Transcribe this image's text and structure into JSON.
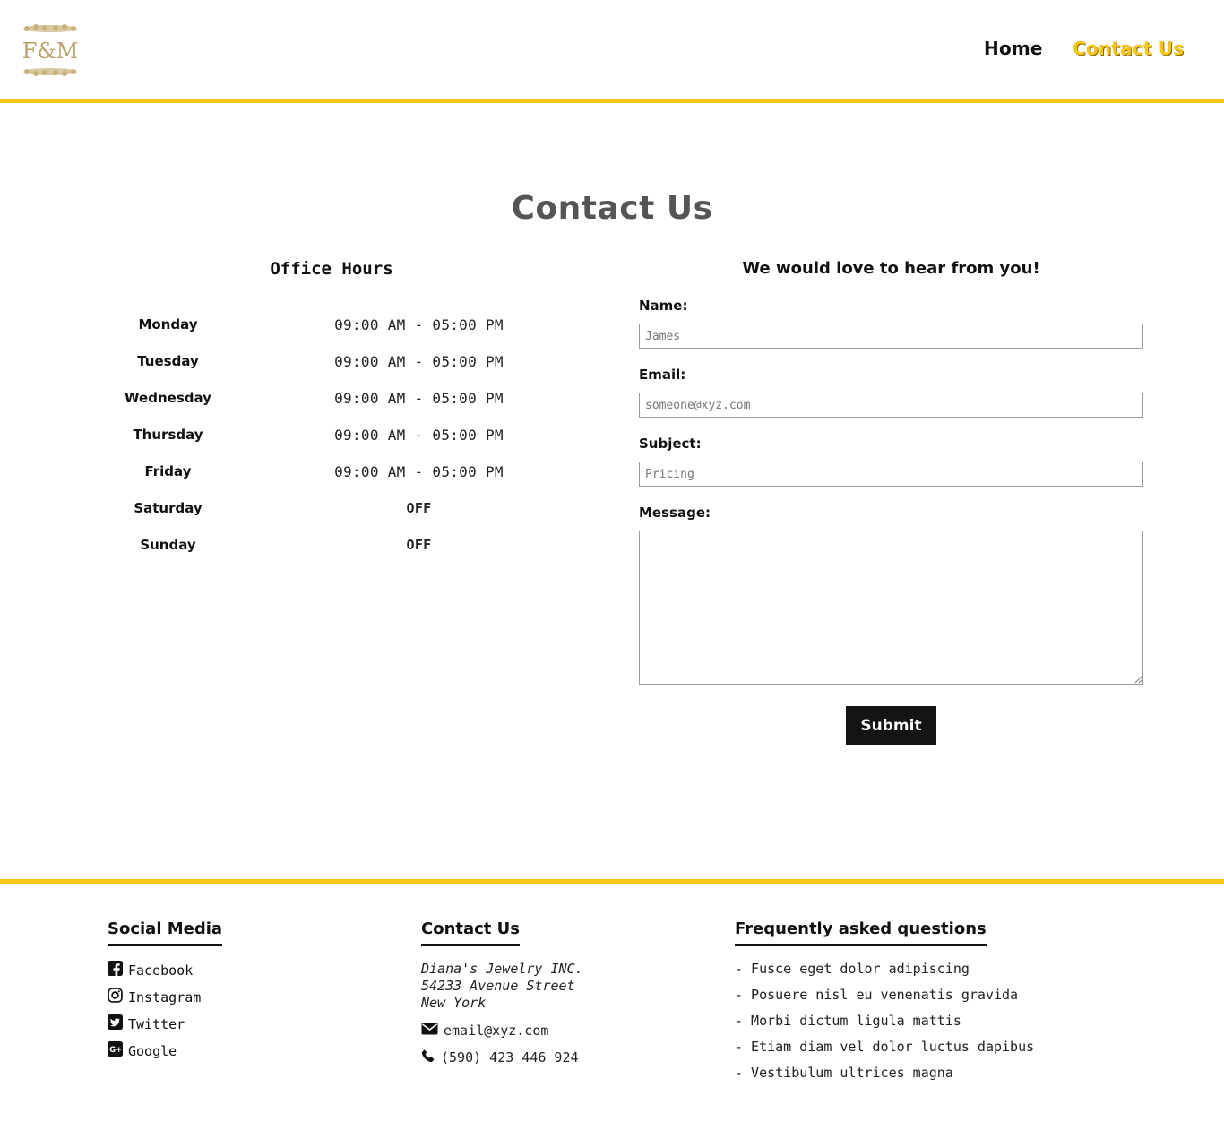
{
  "header": {
    "logo_text": "F&M",
    "nav": [
      {
        "label": "Home"
      },
      {
        "label": "Contact Us"
      }
    ],
    "accent_color": "#f5c518"
  },
  "main": {
    "title": "Contact Us",
    "office_hours": {
      "title": "Office Hours",
      "rows": [
        {
          "day": "Monday",
          "hours": "09:00 AM - 05:00 PM"
        },
        {
          "day": "Tuesday",
          "hours": "09:00 AM - 05:00 PM"
        },
        {
          "day": "Wednesday",
          "hours": "09:00 AM - 05:00 PM"
        },
        {
          "day": "Thursday",
          "hours": "09:00 AM - 05:00 PM"
        },
        {
          "day": "Friday",
          "hours": "09:00 AM - 05:00 PM"
        },
        {
          "day": "Saturday",
          "hours": "OFF"
        },
        {
          "day": "Sunday",
          "hours": "OFF"
        }
      ]
    },
    "form": {
      "title": "We would love to hear from you!",
      "name_label": "Name:",
      "name_placeholder": "James",
      "email_label": "Email:",
      "email_placeholder": "someone@xyz.com",
      "subject_label": "Subject:",
      "subject_placeholder": "Pricing",
      "message_label": "Message:",
      "message_value": "",
      "submit_label": "Submit"
    }
  },
  "footer": {
    "social": {
      "title": "Social Media",
      "items": [
        {
          "label": "Facebook",
          "icon": "facebook-icon"
        },
        {
          "label": "Instagram",
          "icon": "instagram-icon"
        },
        {
          "label": "Twitter",
          "icon": "twitter-icon"
        },
        {
          "label": "Google",
          "icon": "google-plus-icon"
        }
      ]
    },
    "contact": {
      "title": "Contact Us",
      "address_line1": "Diana's Jewelry INC.",
      "address_line2": "54233 Avenue Street",
      "address_line3": "New York",
      "email": "email@xyz.com",
      "phone": "(590) 423 446 924"
    },
    "faq": {
      "title": "Frequently asked questions",
      "items": [
        "- Fusce eget dolor adipiscing",
        "- Posuere nisl eu venenatis gravida",
        "- Morbi dictum ligula mattis",
        "- Etiam diam vel dolor luctus dapibus",
        "- Vestibulum ultrices magna"
      ]
    }
  }
}
